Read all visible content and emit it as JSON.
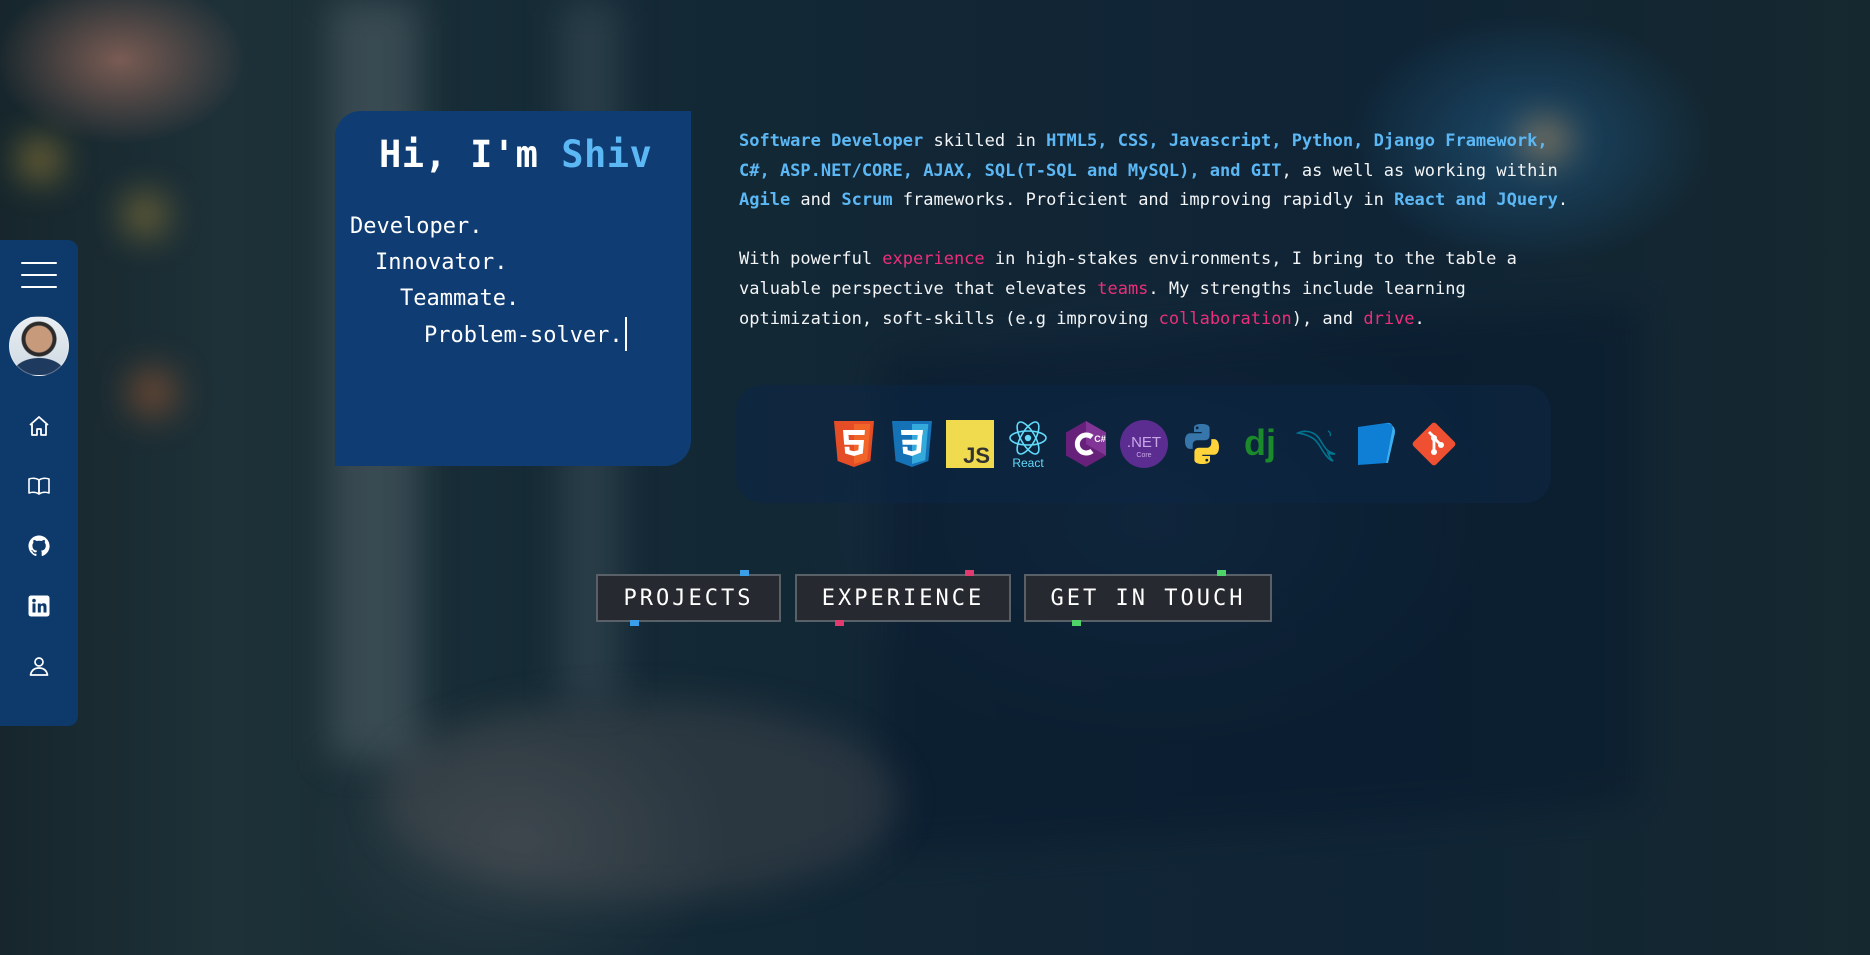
{
  "hero": {
    "greeting": "Hi, I'm ",
    "name": "Shiv",
    "roles": [
      "Developer.",
      "Innovator.",
      "Teammate.",
      "Problem-solver."
    ]
  },
  "about": {
    "p1": [
      {
        "t": "Software Developer",
        "s": "b"
      },
      {
        "t": " skilled in ",
        "s": ""
      },
      {
        "t": "HTML5, CSS, Javascript, Python, Django Framework,",
        "s": "b"
      },
      {
        "t": "\n",
        "s": ""
      },
      {
        "t": "C#, ASP.NET/CORE, AJAX, SQL(T-SQL and MySQL), and GIT",
        "s": "b"
      },
      {
        "t": ", as well as working within",
        "s": ""
      },
      {
        "t": "\n",
        "s": ""
      },
      {
        "t": "Agile",
        "s": "b"
      },
      {
        "t": " and ",
        "s": ""
      },
      {
        "t": "Scrum",
        "s": "b"
      },
      {
        "t": " frameworks. Proficient and improving rapidly in ",
        "s": ""
      },
      {
        "t": "React and JQuery",
        "s": "b"
      },
      {
        "t": ".",
        "s": ""
      }
    ],
    "p2": [
      {
        "t": "With powerful ",
        "s": ""
      },
      {
        "t": "experience",
        "s": "p"
      },
      {
        "t": " in high-stakes environments, I bring to the table a",
        "s": ""
      },
      {
        "t": "\n",
        "s": ""
      },
      {
        "t": "valuable perspective that elevates ",
        "s": ""
      },
      {
        "t": "teams",
        "s": "p"
      },
      {
        "t": ". My strengths include learning",
        "s": ""
      },
      {
        "t": "\n",
        "s": ""
      },
      {
        "t": "optimization, soft-skills (e.g improving ",
        "s": ""
      },
      {
        "t": "collaboration",
        "s": "p"
      },
      {
        "t": "), and ",
        "s": ""
      },
      {
        "t": "drive",
        "s": "p"
      },
      {
        "t": ".",
        "s": ""
      }
    ]
  },
  "tech_icons": [
    "html5-icon",
    "css3-icon",
    "javascript-icon",
    "react-icon",
    "csharp-icon",
    "dotnet-core-icon",
    "python-icon",
    "django-icon",
    "mysql-icon",
    "azure-data-studio-icon",
    "git-icon"
  ],
  "tech_labels": {
    "js": "JS",
    "react": "React",
    "dotnet": ".NET",
    "dotnet_sub": "Core",
    "django": "dj",
    "csharp": "C#"
  },
  "sidebar": {
    "items": [
      "menu-icon",
      "avatar",
      "home-icon",
      "book-icon",
      "github-icon",
      "linkedin-icon",
      "user-icon"
    ]
  },
  "buttons": {
    "projects": "PROJECTS",
    "experience": "EXPERIENCE",
    "contact": "GET IN TOUCH"
  },
  "colors": {
    "accent_blue": "#5cb8f5",
    "accent_pink": "#ec2e7a",
    "card_bg": "#0f3d73",
    "sidebar_bg": "#0d3a6b",
    "projects_corner": "#3a9ee8",
    "experience_corner": "#e03a6e",
    "contact_corner": "#4fd46a"
  }
}
